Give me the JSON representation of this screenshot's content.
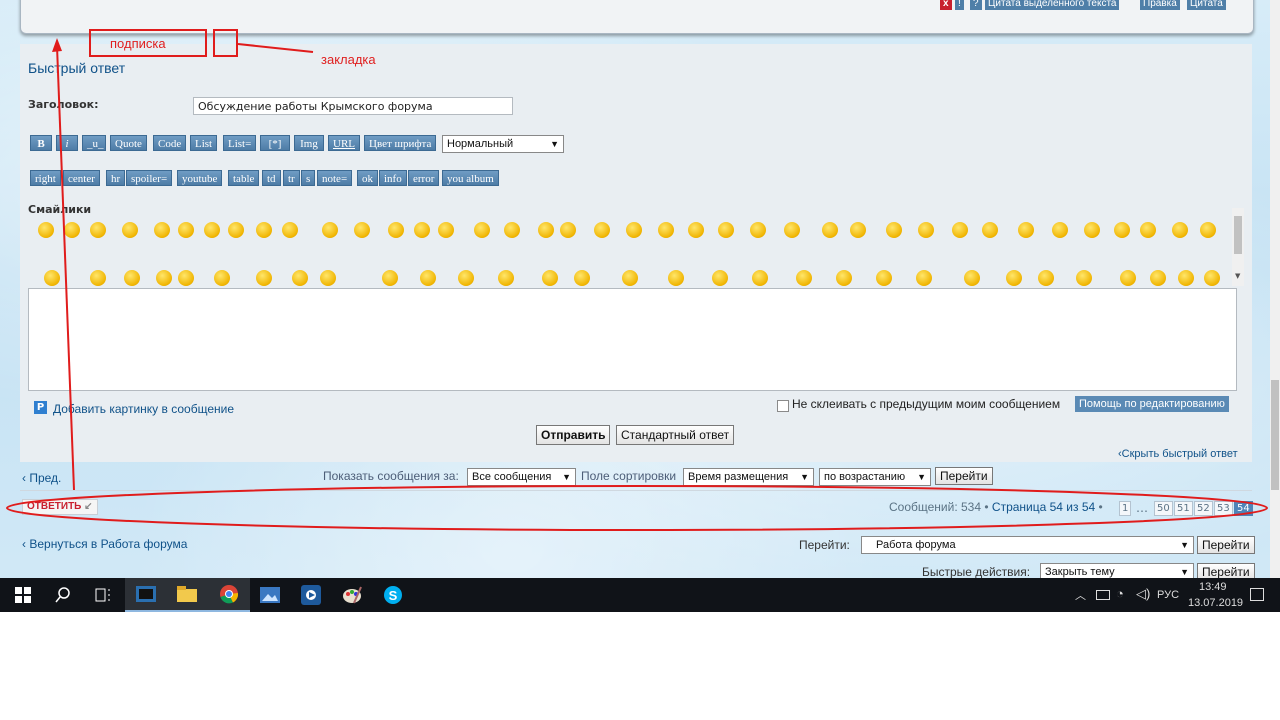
{
  "post_buttons": {
    "report": "x",
    "warn": "!",
    "info": "?",
    "quote_selected": "Цитата выделенного текста",
    "edit": "Правка",
    "quote": "Цитата"
  },
  "annotations": {
    "subscribe": "подписка",
    "bookmark": "закладка"
  },
  "quick_reply": {
    "title": "Быстрый ответ",
    "subject_label": "Заголовок:",
    "subject_value": "Обсуждение работы Крымского форума",
    "toolbar_row1": [
      "B",
      "i",
      "_u_",
      "Quote",
      "Code",
      "List",
      "List=",
      "[*]",
      "Img",
      "URL",
      "Цвет шрифта"
    ],
    "font_size_select": "Нормальный",
    "toolbar_row2": [
      "right",
      "center",
      "hr",
      "spoiler=",
      "youtube",
      "table",
      "td",
      "tr",
      "s",
      "note=",
      "ok",
      "info",
      "error",
      "you album"
    ],
    "smilies_label": "Смайлики",
    "add_image_link": "Добавить картинку в сообщение",
    "no_merge_label": "Не склеивать с предыдущим моим сообщением",
    "help_button": "Помощь по редактированию",
    "submit_button": "Отправить",
    "full_editor_button": "Стандартный ответ",
    "hide_link": "Скрыть быстрый ответ"
  },
  "sort_bar": {
    "prev": "Пред.",
    "show_label": "Показать сообщения за:",
    "show_value": "Все сообщения",
    "sort_label": "Поле сортировки",
    "sort_value": "Время размещения",
    "order_value": "по возрастанию",
    "go": "Перейти"
  },
  "pagination": {
    "reply": "ОТВЕТИТЬ",
    "summary_count": "Сообщений: 534",
    "summary_page": "Страница 54 из 54",
    "dots": "…",
    "pages": [
      "1",
      "50",
      "51",
      "52",
      "53",
      "54"
    ]
  },
  "footer": {
    "back_link": "Вернуться в Работа форума",
    "jump_label": "Перейти:",
    "jump_value": "Работа форума",
    "jump_btn": "Перейти",
    "quick_actions_label": "Быстрые действия:",
    "quick_actions_value": "Закрыть тему",
    "quick_actions_btn": "Перейти"
  },
  "taskbar": {
    "lang": "РУС",
    "time": "13:49",
    "date": "13.07.2019",
    "icons": [
      "windows-start",
      "search",
      "task-view",
      "media-player",
      "file-explorer",
      "chrome",
      "photos",
      "media-center",
      "paint",
      "skype"
    ]
  },
  "colors": {
    "accent": "#105289",
    "annotation_red": "#e01c1c",
    "button_blue": "#4f7fa8",
    "taskbar": "#101318"
  }
}
